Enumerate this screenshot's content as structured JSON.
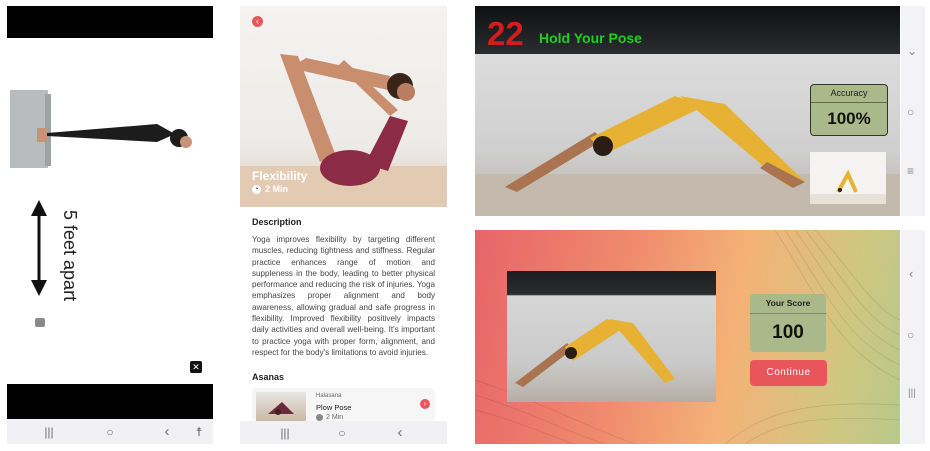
{
  "setup_screen": {
    "distance_label": "5 feet apart"
  },
  "detail_screen": {
    "title": "Flexibility",
    "duration": "2 Min",
    "description_heading": "Description",
    "description_text": "Yoga improves flexibility by targeting different muscles, reducing tightness and stiffness. Regular practice enhances range of motion and suppleness in the body, leading to better physical performance and reducing the risk of injuries. Yoga emphasizes proper alignment and body awareness, allowing gradual and safe progress in flexibility. Improved flexibility positively impacts daily activities and overall well-being. It's important to practice yoga with proper form, alignment, and respect for the body's limitations to avoid injuries.",
    "asanas_heading": "Asanas",
    "asana": {
      "sanskrit": "Halasana",
      "name": "Plow Pose",
      "duration": "2 Min"
    }
  },
  "pose_screen": {
    "countdown": "22",
    "instruction": "Hold Your Pose",
    "accuracy_label": "Accuracy",
    "accuracy_value": "100%"
  },
  "score_screen": {
    "score_label": "Your Score",
    "score_value": "100",
    "continue_label": "Continue"
  },
  "colors": {
    "accent_red": "#e8565c",
    "countdown_red": "#d41c1c",
    "instruction_green": "#1fd11f",
    "panel_green": "#a9b98a",
    "body_purple": "#8b2b46",
    "outfit_yellow": "#e7b233"
  },
  "icons": [
    "back-icon",
    "clock-icon",
    "close-icon",
    "chevron-right-icon",
    "recents-icon",
    "home-icon",
    "back-nav-icon",
    "accessibility-icon"
  ]
}
